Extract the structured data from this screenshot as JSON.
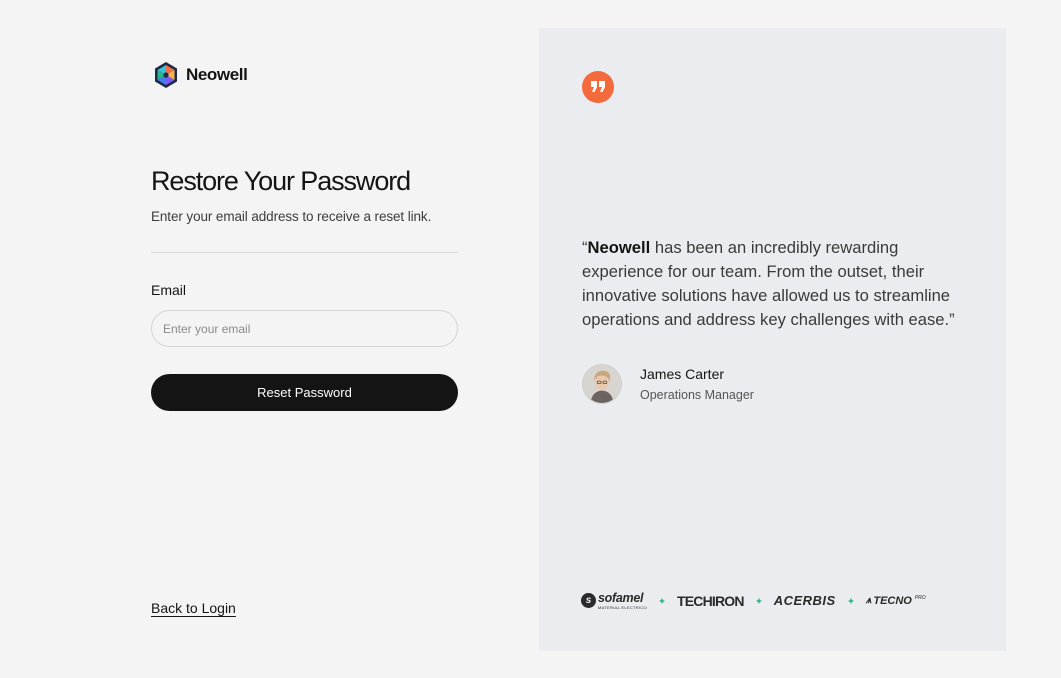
{
  "brand": {
    "name": "Neowell"
  },
  "form": {
    "title": "Restore Your Password",
    "subtitle": "Enter your email address to receive a reset link.",
    "email_label": "Email",
    "email_placeholder": "Enter your email",
    "email_value": "",
    "submit_label": "Reset Password",
    "back_link": "Back to Login"
  },
  "testimonial": {
    "open_quote": "“",
    "brand_in_quote": "Neowell",
    "body": " has been an incredibly rewarding experience for our team. From the outset, their innovative solutions have allowed us to streamline operations and address key challenges with ease.”",
    "author_name": "James Carter",
    "author_role": "Operations Manager"
  },
  "partners": {
    "sofamel": {
      "name": "sofamel",
      "tagline": "MATERIAL ELECTRICO"
    },
    "techiron": {
      "name": "TECHIRON"
    },
    "acerbis": {
      "name": "ACERBIS"
    },
    "tecno": {
      "name": "TECNO",
      "suffix": "PRO"
    }
  },
  "colors": {
    "background": "#f4f4f4",
    "panel": "#ebecef",
    "primary_button": "#141414",
    "quote_badge": "#f36a3d",
    "separator": "#2bb58a"
  },
  "icons": {
    "logo": "hexagon-logo-icon",
    "quote": "quote-icon",
    "separator": "sparkle-separator-icon"
  }
}
